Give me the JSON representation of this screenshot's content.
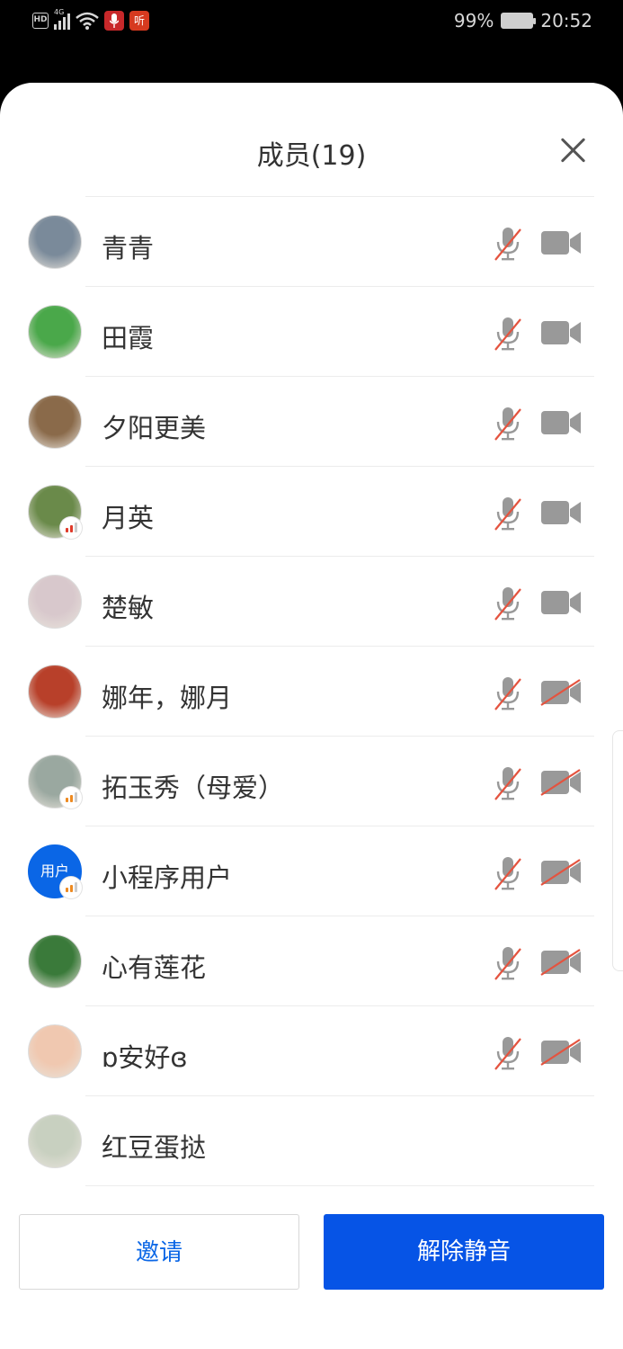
{
  "status_bar": {
    "hd": "HD",
    "network": "4G",
    "ting": "听",
    "battery": "99%",
    "time": "20:52"
  },
  "header": {
    "title": "成员(19)"
  },
  "members": [
    {
      "name": "青青",
      "avatar_color": "#7a8a9a",
      "volume": false,
      "mic": "muted",
      "cam": "on"
    },
    {
      "name": "田霞",
      "avatar_color": "#4aa84a",
      "volume": false,
      "mic": "muted",
      "cam": "on"
    },
    {
      "name": "夕阳更美",
      "avatar_color": "#8a6a4a",
      "volume": false,
      "mic": "muted",
      "cam": "on"
    },
    {
      "name": "月英",
      "avatar_color": "#6a8a4a",
      "volume": true,
      "volume_color": "#e03a2a",
      "mic": "muted",
      "cam": "on"
    },
    {
      "name": "楚敏",
      "avatar_color": "#d8c8cc",
      "volume": false,
      "mic": "muted",
      "cam": "on"
    },
    {
      "name": "娜年，娜月",
      "avatar_color": "#b8402a",
      "volume": false,
      "mic": "muted",
      "cam": "off"
    },
    {
      "name": "拓玉秀（母爱）",
      "avatar_color": "#9aa8a0",
      "volume": true,
      "volume_color": "#ee8a20",
      "mic": "muted",
      "cam": "off"
    },
    {
      "name": "小程序用户",
      "avatar_color": "#0a66e6",
      "avatar_text": "用户",
      "volume": true,
      "volume_color": "#ee8a20",
      "mic": "muted",
      "cam": "off"
    },
    {
      "name": "心有莲花",
      "avatar_color": "#3a7a3a",
      "volume": false,
      "mic": "muted",
      "cam": "off"
    },
    {
      "name": "ɒ安好ɞ",
      "avatar_color": "#f0c8b0",
      "volume": false,
      "mic": "muted",
      "cam": "off"
    },
    {
      "name": "红豆蛋挞",
      "avatar_color": "#c8d0c0",
      "volume": false,
      "mic": "none",
      "cam": "none"
    }
  ],
  "buttons": {
    "invite": "邀请",
    "unmute": "解除静音"
  },
  "colors": {
    "accent": "#0654e6",
    "mute_slash": "#e4533f",
    "icon_gray": "#999999"
  }
}
